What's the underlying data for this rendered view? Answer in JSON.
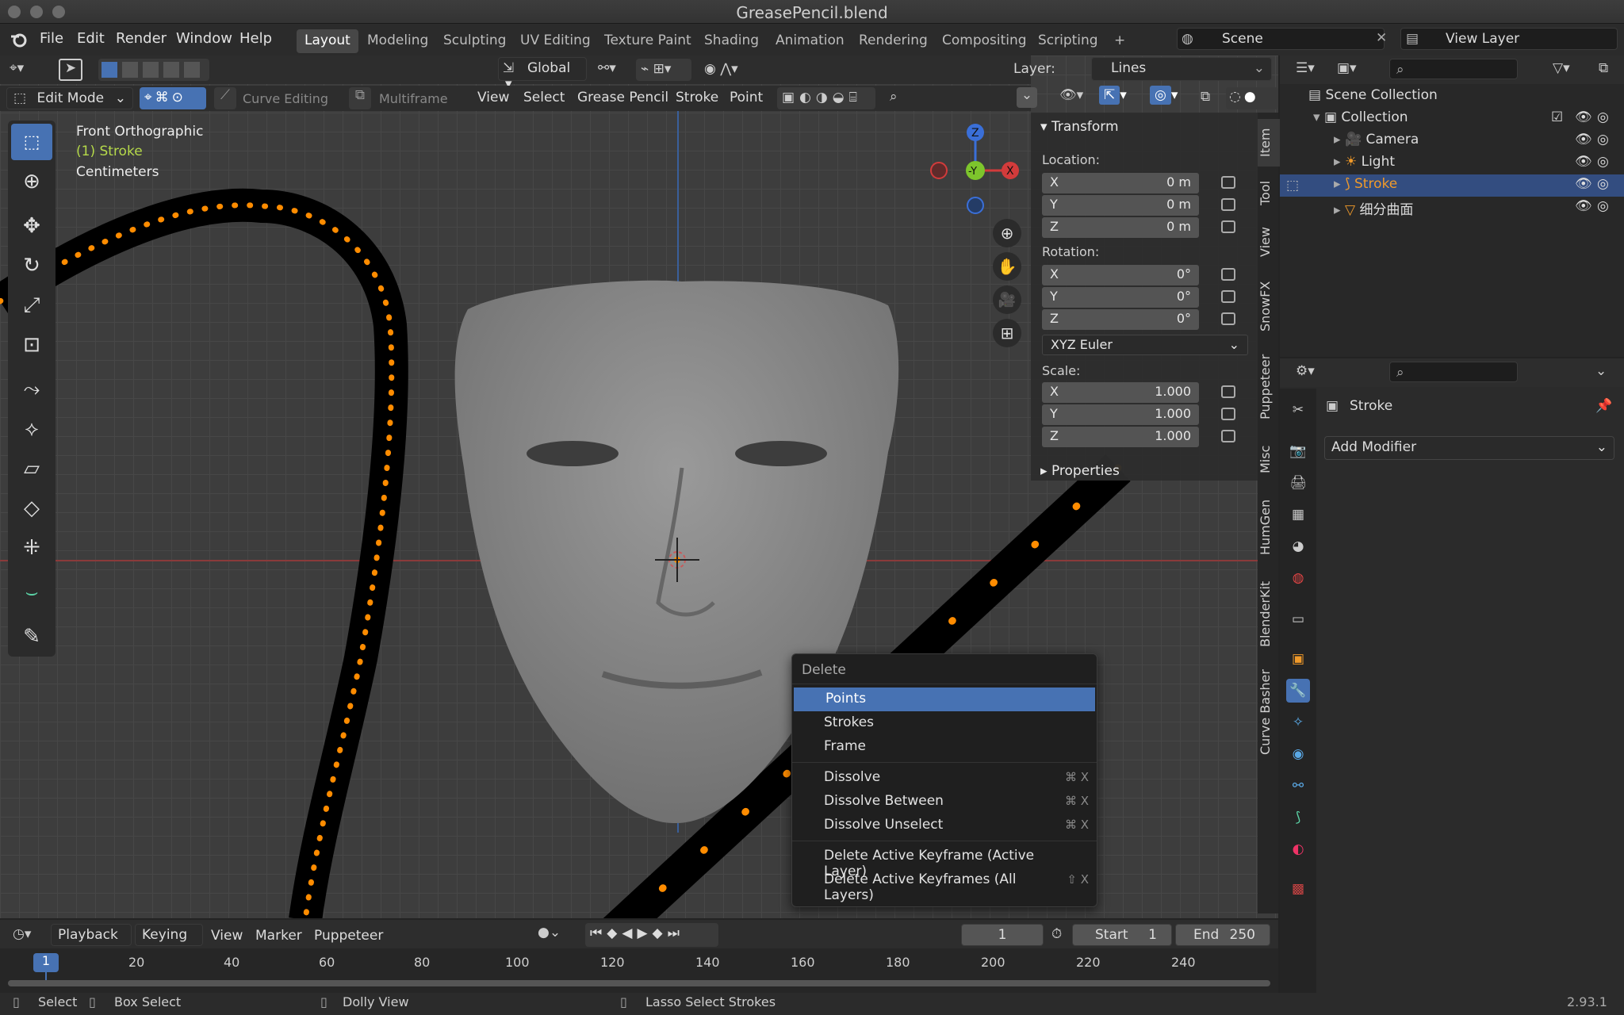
{
  "window": {
    "title": "GreasePencil.blend",
    "version": "2.93.1"
  },
  "menu": {
    "file": "File",
    "edit": "Edit",
    "render": "Render",
    "window": "Window",
    "help": "Help"
  },
  "workspaces": [
    "Layout",
    "Modeling",
    "Sculpting",
    "UV Editing",
    "Texture Paint",
    "Shading",
    "Animation",
    "Rendering",
    "Compositing",
    "Scripting",
    "+"
  ],
  "scene": {
    "name": "Scene",
    "view_layer": "View Layer"
  },
  "viewport_header": {
    "orientation": "Global",
    "layer_label": "Layer:",
    "layer_value": "Lines",
    "mode": "Edit Mode",
    "curve_editing": "Curve Editing",
    "multiframe": "Multiframe",
    "menus": [
      "View",
      "Select",
      "Grease Pencil",
      "Stroke",
      "Point"
    ]
  },
  "overlay": {
    "view_name": "Front Orthographic",
    "object": "(1) Stroke",
    "units": "Centimeters"
  },
  "gizmo": {
    "z": "Z",
    "y": "-Y",
    "x": "X"
  },
  "npanel": {
    "tabs": [
      "Item",
      "Tool",
      "View",
      "SnowFX",
      "Puppeteer",
      "Misc",
      "HumGen",
      "BlenderKit",
      "Curve Basher"
    ],
    "transform_title": "Transform",
    "location_label": "Location:",
    "location": [
      {
        "axis": "X",
        "value": "0 m"
      },
      {
        "axis": "Y",
        "value": "0 m"
      },
      {
        "axis": "Z",
        "value": "0 m"
      }
    ],
    "rotation_label": "Rotation:",
    "rotation": [
      {
        "axis": "X",
        "value": "0°"
      },
      {
        "axis": "Y",
        "value": "0°"
      },
      {
        "axis": "Z",
        "value": "0°"
      }
    ],
    "rotation_mode": "XYZ Euler",
    "scale_label": "Scale:",
    "scale": [
      {
        "axis": "X",
        "value": "1.000"
      },
      {
        "axis": "Y",
        "value": "1.000"
      },
      {
        "axis": "Z",
        "value": "1.000"
      }
    ],
    "properties_title": "Properties"
  },
  "outliner": {
    "scene_collection": "Scene Collection",
    "collection": "Collection",
    "items": [
      "Camera",
      "Light",
      "Stroke",
      "细分曲面"
    ]
  },
  "properties": {
    "object": "Stroke",
    "add_modifier": "Add Modifier"
  },
  "context_menu": {
    "title": "Delete",
    "items": [
      {
        "label": "Points",
        "shortcut": ""
      },
      {
        "label": "Strokes",
        "shortcut": ""
      },
      {
        "label": "Frame",
        "shortcut": ""
      },
      {
        "label": "Dissolve",
        "shortcut": "⌘ X"
      },
      {
        "label": "Dissolve Between",
        "shortcut": "⌘ X"
      },
      {
        "label": "Dissolve Unselect",
        "shortcut": "⌘ X"
      },
      {
        "label": "Delete Active Keyframe (Active Layer)",
        "shortcut": ""
      },
      {
        "label": "Delete Active Keyframes (All Layers)",
        "shortcut": "⇧ X"
      }
    ]
  },
  "timeline": {
    "menus": [
      "Playback",
      "Keying",
      "View",
      "Marker",
      "Puppeteer"
    ],
    "current_frame": "1",
    "start_label": "Start",
    "start": "1",
    "end_label": "End",
    "end": "250",
    "ticks": [
      "20",
      "40",
      "60",
      "80",
      "100",
      "120",
      "140",
      "160",
      "180",
      "200",
      "220",
      "240"
    ],
    "playhead": "1"
  },
  "statusbar": {
    "select": "Select",
    "box_select": "Box Select",
    "dolly": "Dolly View",
    "lasso": "Lasso Select Strokes"
  },
  "colors": {
    "accent": "#4772b3",
    "orange": "#ff8c00",
    "active_text": "#f09a2a"
  }
}
